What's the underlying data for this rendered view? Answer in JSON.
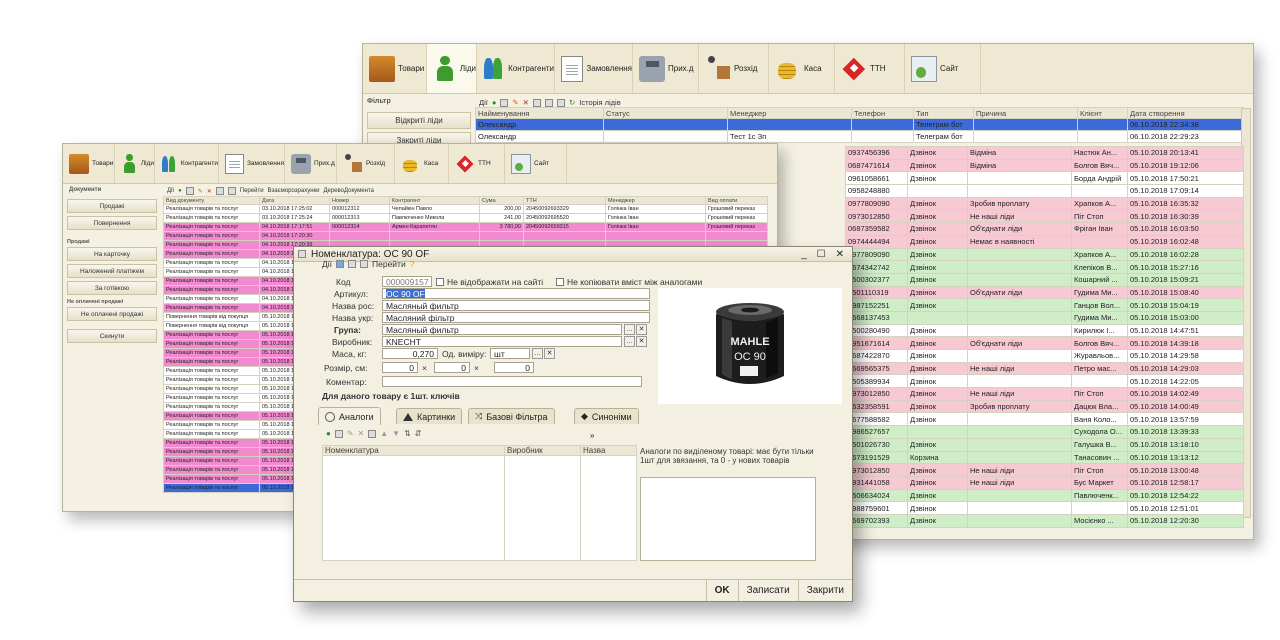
{
  "crm_window": {
    "toolbar": [
      {
        "label": "Товари",
        "icon": "goods-icon"
      },
      {
        "label": "Ліди",
        "icon": "lead-person-icon"
      },
      {
        "label": "Контрагенти",
        "icon": "contractors-icon"
      },
      {
        "label": "Замовлення",
        "icon": "orders-icon"
      },
      {
        "label": "Прих.д",
        "icon": "receipt-robot-icon"
      },
      {
        "label": "Розхід",
        "icon": "expense-delivery-icon"
      },
      {
        "label": "Каса",
        "icon": "cash-coins-icon"
      },
      {
        "label": "ТТН",
        "icon": "tth-icon"
      },
      {
        "label": "Сайт",
        "icon": "site-icon"
      }
    ],
    "filter_label": "Фільтр",
    "actions_label": "Дії",
    "history_label": "Історія лідів",
    "side_buttons": [
      "Відкриті ліди",
      "Закриті ліди"
    ],
    "columns": [
      "Найменування",
      "Статус",
      "Менеджер",
      "Телефон",
      "Тип",
      "Причина",
      "Клієнт",
      "Дата створення"
    ],
    "top_rows": [
      {
        "name": "Олександр",
        "status": "",
        "manager": "",
        "phone": "",
        "type": "Телеграм бот",
        "reason": "",
        "client": "",
        "date": "06.10.2018 22:34:38",
        "style": "sel"
      },
      {
        "name": "Олександр",
        "status": "",
        "manager": "Тест 1с Зп",
        "phone": "",
        "type": "Телеграм бот",
        "reason": "",
        "client": "",
        "date": "06.10.2018 22:29:23",
        "style": "white"
      }
    ],
    "right_rows": [
      {
        "phone": "0937456396",
        "type": "Дзвінок",
        "reason": "Відміна",
        "client": "Настюк Ан...",
        "date": "05.10.2018 20:13:41",
        "style": "pink"
      },
      {
        "phone": "0687471614",
        "type": "Дзвінок",
        "reason": "Відміна",
        "client": "Болгов Вяч...",
        "date": "05.10.2018 19:12:06",
        "style": "pink"
      },
      {
        "phone": "0961058661",
        "type": "Дзвінок",
        "reason": "",
        "client": "Борда Андрій",
        "date": "05.10.2018 17:50:21",
        "style": "white"
      },
      {
        "phone": "0958248880",
        "type": "",
        "reason": "",
        "client": "",
        "date": "05.10.2018 17:09:14",
        "style": "white"
      },
      {
        "phone": "0977809090",
        "type": "Дзвінок",
        "reason": "Зробив проплату",
        "client": "Храпков А...",
        "date": "05.10.2018 16:35:32",
        "style": "pink"
      },
      {
        "phone": "0973012850",
        "type": "Дзвінок",
        "reason": "Не наші ліди",
        "client": "Піт Стоп",
        "date": "05.10.2018 16:30:39",
        "style": "pink"
      },
      {
        "phone": "0687359582",
        "type": "Дзвінок",
        "reason": "Об'єднати ліди",
        "client": "Фріган Іван",
        "date": "05.10.2018 16:03:50",
        "style": "pink"
      },
      {
        "phone": "0974444494",
        "type": "Дзвінок",
        "reason": "Немає в наявності",
        "client": "",
        "date": "05.10.2018 16:02:48",
        "style": "pink"
      },
      {
        "phone": "0977809090",
        "type": "Дзвінок",
        "reason": "",
        "client": "Храпков А...",
        "date": "05.10.2018 16:02:28",
        "style": "green"
      },
      {
        "phone": "0674342742",
        "type": "Дзвінок",
        "reason": "",
        "client": "Клепіков В...",
        "date": "05.10.2018 15:27:16",
        "style": "green"
      },
      {
        "phone": "0500302377",
        "type": "Дзвінок",
        "reason": "",
        "client": "Кошарний ...",
        "date": "05.10.2018 15:09:21",
        "style": "green"
      },
      {
        "phone": "0501110319",
        "type": "Дзвінок",
        "reason": "Об'єднати ліди",
        "client": "Гудима Ми...",
        "date": "05.10.2018 15:08:40",
        "style": "pink"
      },
      {
        "phone": "0987152251",
        "type": "Дзвінок",
        "reason": "",
        "client": "Ганцов Вол...",
        "date": "05.10.2018 15:04:19",
        "style": "green"
      },
      {
        "phone": "0668137453",
        "type": "",
        "reason": "",
        "client": "Гудима Ми...",
        "date": "05.10.2018 15:03:00",
        "style": "green"
      },
      {
        "phone": "0500280490",
        "type": "Дзвінок",
        "reason": "",
        "client": "Кирилюк І...",
        "date": "05.10.2018 14:47:51",
        "style": "white"
      },
      {
        "phone": "0951671614",
        "type": "Дзвінок",
        "reason": "Об'єднати ліди",
        "client": "Болгов Вяч...",
        "date": "05.10.2018 14:39:18",
        "style": "pink"
      },
      {
        "phone": "0687422870",
        "type": "Дзвінок",
        "reason": "",
        "client": "Журавльов...",
        "date": "05.10.2018 14:29:58",
        "style": "white"
      },
      {
        "phone": "0669565375",
        "type": "Дзвінок",
        "reason": "Не наші ліди",
        "client": "Петро мас...",
        "date": "05.10.2018 14:29:03",
        "style": "pink"
      },
      {
        "phone": "0505389934",
        "type": "Дзвінок",
        "reason": "",
        "client": "",
        "date": "05.10.2018 14:22:05",
        "style": "white"
      },
      {
        "phone": "0973012850",
        "type": "Дзвінок",
        "reason": "Не наші ліди",
        "client": "Піт Стоп",
        "date": "05.10.2018 14:02:49",
        "style": "pink"
      },
      {
        "phone": "0632358591",
        "type": "Дзвінок",
        "reason": "Зробив проплату",
        "client": "Дацюк Вла...",
        "date": "05.10.2018 14:00:49",
        "style": "pink"
      },
      {
        "phone": "0677588582",
        "type": "Дзвінок",
        "reason": "",
        "client": "Ваня Коло...",
        "date": "05.10.2018 13:57:59",
        "style": "white"
      },
      {
        "phone": "0986527657",
        "type": "",
        "reason": "",
        "client": "Суходола О...",
        "date": "05.10.2018 13:39:33",
        "style": "green"
      },
      {
        "phone": "0501026730",
        "type": "Дзвінок",
        "reason": "",
        "client": "Галушка В...",
        "date": "05.10.2018 13:18:10",
        "style": "green"
      },
      {
        "phone": "0673191529",
        "type": "Корзина",
        "reason": "",
        "client": "Танасовин ...",
        "date": "05.10.2018 13:13:12",
        "style": "green"
      },
      {
        "phone": "0973012850",
        "type": "Дзвінок",
        "reason": "Не наші ліди",
        "client": "Піт Стоп",
        "date": "05.10.2018 13:00:48",
        "style": "pink"
      },
      {
        "phone": "0931441058",
        "type": "Дзвінок",
        "reason": "Не наші ліди",
        "client": "Бус Маркет",
        "date": "05.10.2018 12:58:17",
        "style": "pink"
      },
      {
        "phone": "0506634024",
        "type": "Дзвінок",
        "reason": "",
        "client": "Павлюченк...",
        "date": "05.10.2018 12:54:22",
        "style": "green"
      },
      {
        "phone": "0988759601",
        "type": "Дзвінок",
        "reason": "",
        "client": "",
        "date": "05.10.2018 12:51:01",
        "style": "white"
      },
      {
        "phone": "0669702393",
        "type": "Дзвінок",
        "reason": "",
        "client": "Мосієнко ...",
        "date": "05.10.2018 12:20:30",
        "style": "green"
      }
    ]
  },
  "docs_window": {
    "toolbar": [
      {
        "label": "Товари",
        "icon": "goods-icon"
      },
      {
        "label": "Ліди",
        "icon": "lead-person-icon"
      },
      {
        "label": "Контрагенти",
        "icon": "contractors-icon"
      },
      {
        "label": "Замовлення",
        "icon": "orders-icon"
      },
      {
        "label": "Прих.д",
        "icon": "receipt-robot-icon"
      },
      {
        "label": "Розхід",
        "icon": "expense-delivery-icon"
      },
      {
        "label": "Каса",
        "icon": "cash-coins-icon"
      },
      {
        "label": "ТТН",
        "icon": "tth-icon"
      },
      {
        "label": "Сайт",
        "icon": "site-icon"
      }
    ],
    "section_label": "Документи",
    "actions_label": "Дії",
    "goto_label": "Перейти",
    "links": [
      "Взаєморозрахунки",
      "ДеревоДокумента"
    ],
    "side_items": [
      {
        "label": "Продажі",
        "type": "button"
      },
      {
        "label": "Повернення",
        "type": "button"
      },
      {
        "label": "Продажі",
        "type": "header"
      },
      {
        "label": "На карточку",
        "type": "button"
      },
      {
        "label": "Наложений платіжем",
        "type": "button"
      },
      {
        "label": "За готівкою",
        "type": "button"
      },
      {
        "label": "Не оплачені продажі",
        "type": "header"
      },
      {
        "label": "Не оплачені продажі",
        "type": "button"
      },
      {
        "label": "Скинути",
        "type": "button"
      }
    ],
    "columns": [
      "Вид документу",
      "Дата",
      "Номер",
      "Контрагент",
      "Сума",
      "ТТН",
      "Менеджер",
      "Вид оплати"
    ],
    "rows": [
      {
        "doc": "Реалізація товарів та послуг",
        "date": "03.10.2018 17:25:02",
        "num": "000012312",
        "agent": "Чепайкін Павло",
        "sum": "200,00",
        "tth": "20450092693329",
        "mgr": "Голінка Іван",
        "pay": "Грошовий переказ",
        "style": "white"
      },
      {
        "doc": "Реалізація товарів та послуг",
        "date": "03.10.2018 17:25:24",
        "num": "000012313",
        "agent": "Павлюченко Микола",
        "sum": "241,00",
        "tth": "20450092695520",
        "mgr": "Голінка Іван",
        "pay": "Грошовий переказ",
        "style": "white"
      },
      {
        "doc": "Реалізація товарів та послуг",
        "date": "04.10.2018 17:17:51",
        "num": "000012314",
        "agent": "Армен Карапетян",
        "sum": "3 780,00",
        "tth": "20450092659315",
        "mgr": "Голінка Іван",
        "pay": "Грошовий переказ",
        "style": "magenta"
      },
      {
        "doc": "Реалізація товарів та послуг",
        "date": "04.10.2018 17:20:30",
        "style": "magenta"
      },
      {
        "doc": "Реалізація товарів та послуг",
        "date": "04.10.2018 17:20:39",
        "style": "magenta"
      },
      {
        "doc": "Реалізація товарів та послуг",
        "date": "04.10.2018 17:20:45",
        "style": "magenta"
      },
      {
        "doc": "Реалізація товарів та послуг",
        "date": "04.10.2018 17:20:59",
        "style": "white"
      },
      {
        "doc": "Реалізація товарів та послуг",
        "date": "04.10.2018 17:21:31",
        "style": "white"
      },
      {
        "doc": "Реалізація товарів та послуг",
        "date": "04.10.2018 17:21:37",
        "style": "magenta"
      },
      {
        "doc": "Реалізація товарів та послуг",
        "date": "04.10.2018 17:22:41",
        "style": "magenta"
      },
      {
        "doc": "Реалізація товарів та послуг",
        "date": "04.10.2018 17:22:49",
        "style": "white"
      },
      {
        "doc": "Реалізація товарів та послуг",
        "date": "04.10.2018 17:22:59",
        "style": "magenta"
      },
      {
        "doc": "Повернення товарів від покупця",
        "date": "05.10.2018 10:15:58",
        "style": "white"
      },
      {
        "doc": "Повернення товарів від покупця",
        "date": "05.10.2018 10:16:56",
        "style": "white"
      },
      {
        "doc": "Реалізація товарів та послуг",
        "date": "05.10.2018 17:02:19",
        "style": "magenta"
      },
      {
        "doc": "Реалізація товарів та послуг",
        "date": "05.10.2018 17:02:27",
        "style": "magenta"
      },
      {
        "doc": "Реалізація товарів та послуг",
        "date": "05.10.2018 17:02:34",
        "style": "magenta"
      },
      {
        "doc": "Реалізація товарів та послуг",
        "date": "05.10.2018 17:02:42",
        "style": "magenta"
      },
      {
        "doc": "Реалізація товарів та послуг",
        "date": "05.10.2018 17:02:49",
        "style": "white"
      },
      {
        "doc": "Реалізація товарів та послуг",
        "date": "05.10.2018 17:03:35",
        "style": "white"
      },
      {
        "doc": "Реалізація товарів та послуг",
        "date": "05.10.2018 17:05:04",
        "style": "white"
      },
      {
        "doc": "Реалізація товарів та послуг",
        "date": "05.10.2018 17:05:17",
        "style": "white"
      },
      {
        "doc": "Реалізація товарів та послуг",
        "date": "05.10.2018 17:05:25",
        "style": "white"
      },
      {
        "doc": "Реалізація товарів та послуг",
        "date": "05.10.2018 17:05:33",
        "style": "magenta"
      },
      {
        "doc": "Реалізація товарів та послуг",
        "date": "05.10.2018 17:05:39",
        "style": "white"
      },
      {
        "doc": "Реалізація товарів та послуг",
        "date": "05.10.2018 17:05:55",
        "style": "white"
      },
      {
        "doc": "Реалізація товарів та послуг",
        "date": "05.10.2018 17:06:04",
        "style": "magenta"
      },
      {
        "doc": "Реалізація товарів та послуг",
        "date": "05.10.2018 17:06:10",
        "style": "magenta"
      },
      {
        "doc": "Реалізація товарів та послуг",
        "date": "05.10.2018 17:09:28",
        "style": "magenta"
      },
      {
        "doc": "Реалізація товарів та послуг",
        "date": "05.10.2018 17:09:46",
        "style": "magenta"
      },
      {
        "doc": "Реалізація товарів та послуг",
        "date": "05.10.2018 17:09:53",
        "style": "magenta"
      },
      {
        "doc": "Реалізація товарів та послуг",
        "date": "05.10.2018 17:10:00",
        "style": "sel"
      }
    ]
  },
  "dialog": {
    "title": "Номенклатура: ОС 90 OF",
    "actions_label": "Дії",
    "goto_label": "Перейти",
    "labels": {
      "code": "Код",
      "article": "Артикул:",
      "name_ru": "Назва рос:",
      "name_ua": "Назва укр:",
      "group": "Група:",
      "maker": "Виробник:",
      "mass": "Маса, кг:",
      "unit": "Од. виміру:",
      "size": "Розмір, см:",
      "comment": "Коментар:",
      "keys_note": "Для даного товару є 1шт. ключів"
    },
    "values": {
      "code": "000009157",
      "article": "OC 90 OF",
      "name_ru": "Масляный фильтр",
      "name_ua": "Масляний фільтр",
      "group": "Масляный фильтр",
      "maker": "KNECHT",
      "mass": "0,270",
      "unit": "шт",
      "size_a": "0",
      "size_b": "0",
      "size_c": "0",
      "comment": ""
    },
    "checks": [
      "Не відображати на сайті",
      "Не копіювати вміст між аналогами"
    ],
    "image_brand": "MAHLE",
    "image_model": "OC 90",
    "tabs": [
      "Аналоги",
      "Картинки",
      "Базові Фільтра",
      "Синоніми"
    ],
    "grid_columns": [
      "Номенклатура",
      "Виробник",
      "Назва"
    ],
    "analog_note": "Аналоги по виділеному товарі: має бути тільки 1шт для звязання, та 0 - у нових товарів",
    "footer": [
      "OK",
      "Записати",
      "Закрити"
    ]
  },
  "colors": {
    "pink": "#f7c9d3",
    "green": "#cfeec8",
    "magenta": "#f28ad0",
    "selected": "#3c6ad8",
    "window_bg": "#f4f1e3"
  }
}
